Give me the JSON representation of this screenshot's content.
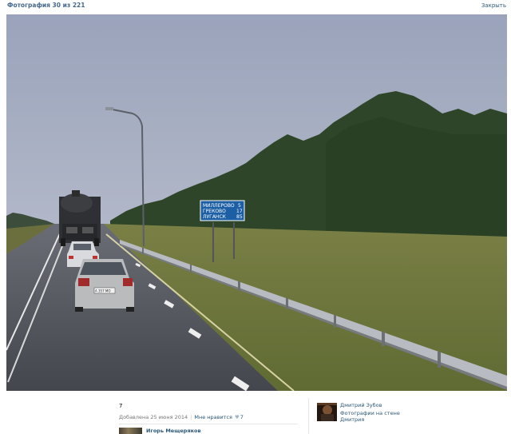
{
  "header": {
    "photo_counter": "Фотография 30 из 221",
    "close_label": "Закрыть"
  },
  "photo": {
    "road_sign": {
      "lines": [
        {
          "place": "МИЛЛЕРОВО",
          "km": "5"
        },
        {
          "place": "ГРЕКОВО",
          "km": "17"
        },
        {
          "place": "ЛУГАНСК",
          "km": "85"
        }
      ]
    },
    "plate_text": "А 357 МО",
    "colors": {
      "sky": "#a3abc1",
      "trees": "#2f4a2a",
      "grass": "#6f7a3a",
      "road": "#4a4d55",
      "sign": "#1d5fa5"
    }
  },
  "info": {
    "caption": "7",
    "added": "Добавлена 25 июня 2014",
    "like_label": "Мне нравится",
    "like_icon": "heart-icon",
    "likes_count": "7",
    "comment_author": "Игорь Мещеряков",
    "owner_name": "Дмитрий Зубов",
    "album_line1": "Фотографии на стене",
    "album_line2": "Дмитрия"
  }
}
